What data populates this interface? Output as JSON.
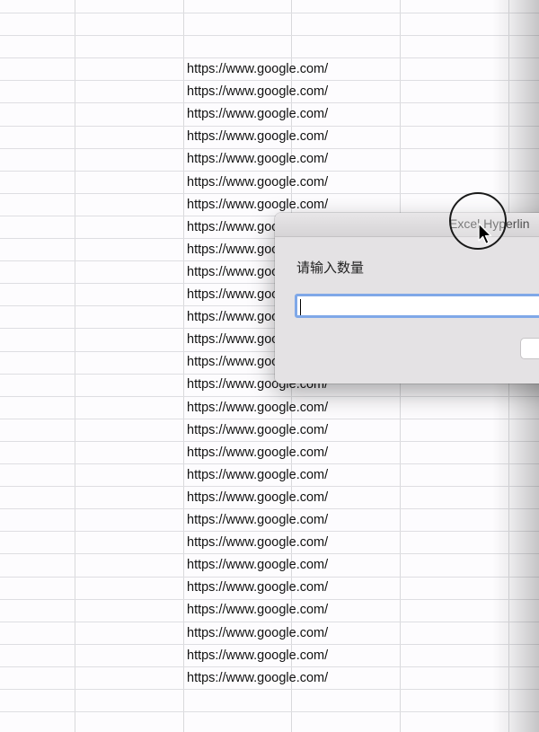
{
  "spreadsheet": {
    "url_cells": [
      "https://www.google.com/",
      "https://www.google.com/",
      "https://www.google.com/",
      "https://www.google.com/",
      "https://www.google.com/",
      "https://www.google.com/",
      "https://www.google.com/",
      "https://www.goo",
      "https://www.goo",
      "https://www.goo",
      "https://www.goo",
      "https://www.goo",
      "https://www.goo",
      "https://www.goo",
      "https://www.google.com/",
      "https://www.google.com/",
      "https://www.google.com/",
      "https://www.google.com/",
      "https://www.google.com/",
      "https://www.google.com/",
      "https://www.google.com/",
      "https://www.google.com/",
      "https://www.google.com/",
      "https://www.google.com/",
      "https://www.google.com/",
      "https://www.google.com/",
      "https://www.google.com/",
      "https://www.google.com/"
    ]
  },
  "dialog": {
    "title": "Excel Hyperlin",
    "prompt": "请输入数量",
    "input_value": "",
    "colors": {
      "input_focus_border": "#7fa8e8",
      "body_background": "#e4e2e4"
    }
  },
  "icons": {
    "cursor": "arrow-pointer-icon",
    "cursor_highlight": "cursor-highlight-ring-icon"
  }
}
